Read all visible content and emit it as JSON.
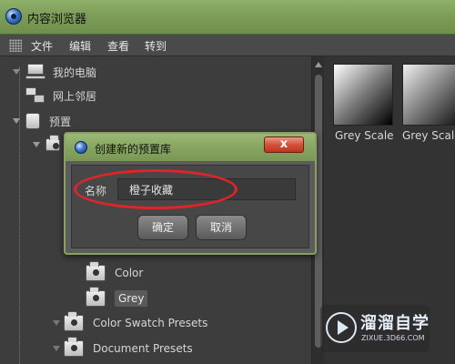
{
  "window": {
    "title": "内容浏览器"
  },
  "menu": {
    "items": [
      "文件",
      "编辑",
      "查看",
      "转到"
    ]
  },
  "tree": {
    "items": [
      {
        "label": "我的电脑"
      },
      {
        "label": "网上邻居"
      },
      {
        "label": "预置"
      },
      {
        "label": "Color"
      },
      {
        "label": "Grey"
      },
      {
        "label": "Color Swatch Presets"
      },
      {
        "label": "Document Presets"
      }
    ]
  },
  "content": {
    "thumbnails": [
      {
        "label": "Grey Scale"
      },
      {
        "label": "Grey Scale"
      }
    ]
  },
  "dialog": {
    "title": "创建新的预置库",
    "close_label": "x",
    "name_label": "名称",
    "name_value": "橙子收藏",
    "ok_label": "确定",
    "cancel_label": "取消"
  },
  "watermark": {
    "title": "溜溜自学",
    "subtitle": "ZIXUE.3D66.COM"
  },
  "colors": {
    "title_bar": "#7d9e58",
    "panel_bg": "#3d3d3d",
    "highlight": "#e0242a",
    "close_button": "#d4523a"
  },
  "icons": {
    "app": "cinema4d-logo-icon",
    "computer": "computer-icon",
    "network": "network-icon",
    "presets": "presets-icon",
    "folder": "folder-icon"
  }
}
